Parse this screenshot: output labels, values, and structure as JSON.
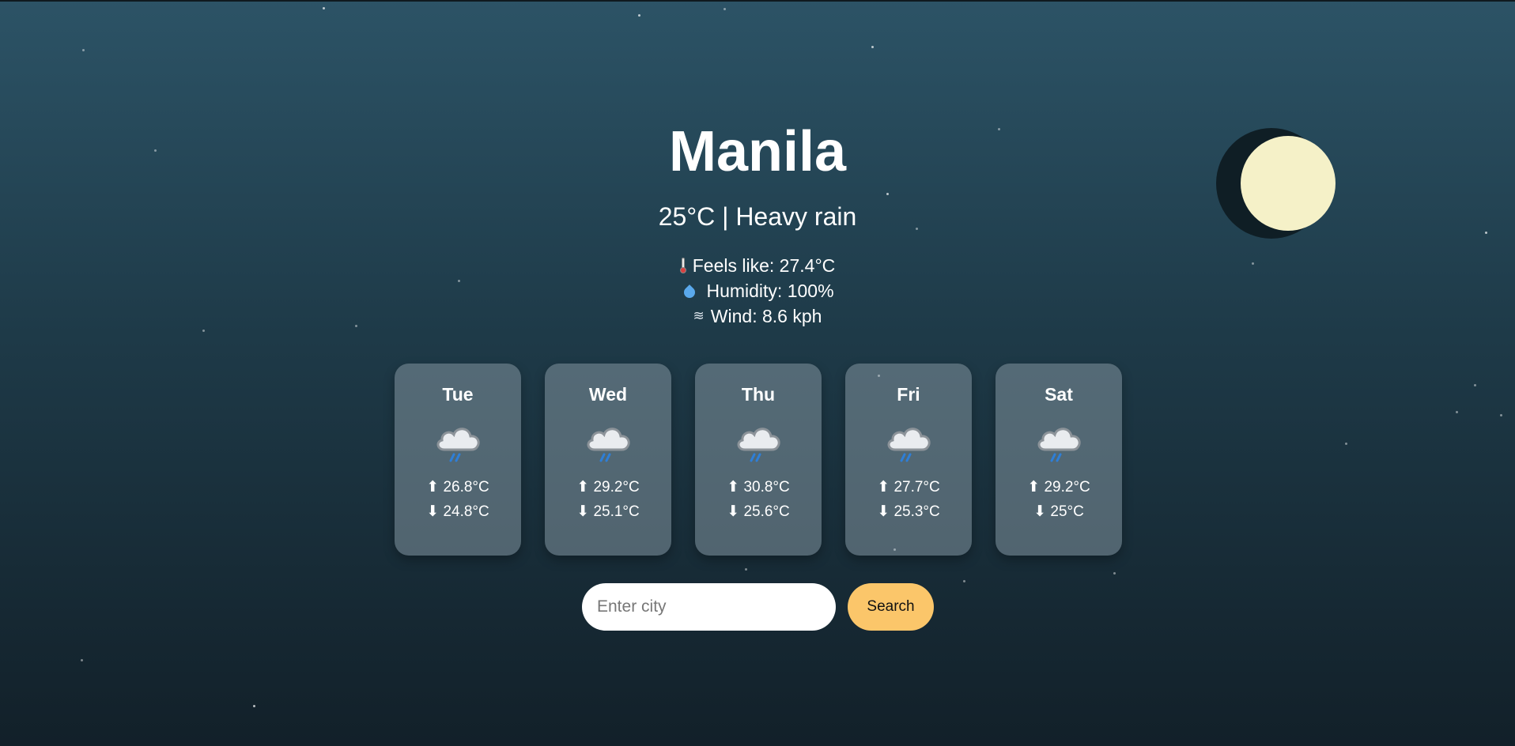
{
  "current": {
    "city": "Manila",
    "summary": "25°C | Heavy rain",
    "feels_like": "Feels like: 27.4°C",
    "humidity": "Humidity: 100%",
    "wind": "Wind: 8.6 kph"
  },
  "icons": {
    "feels_like": "thermometer-icon",
    "humidity": "droplet-icon",
    "wind": "wind-icon",
    "forecast": "rain-cloud-icon",
    "sky": "moon-icon"
  },
  "forecast": [
    {
      "day": "Tue",
      "high": "⬆ 26.8°C",
      "low": "⬇ 24.8°C"
    },
    {
      "day": "Wed",
      "high": "⬆ 29.2°C",
      "low": "⬇ 25.1°C"
    },
    {
      "day": "Thu",
      "high": "⬆ 30.8°C",
      "low": "⬇ 25.6°C"
    },
    {
      "day": "Fri",
      "high": "⬆ 27.7°C",
      "low": "⬇ 25.3°C"
    },
    {
      "day": "Sat",
      "high": "⬆ 29.2°C",
      "low": "⬇ 25°C"
    }
  ],
  "search": {
    "placeholder": "Enter city",
    "button_label": "Search"
  },
  "colors": {
    "background_top": "#2c5366",
    "background_bottom": "#122029",
    "moon": "#f5f1c8",
    "search_button": "#fbc66a"
  }
}
